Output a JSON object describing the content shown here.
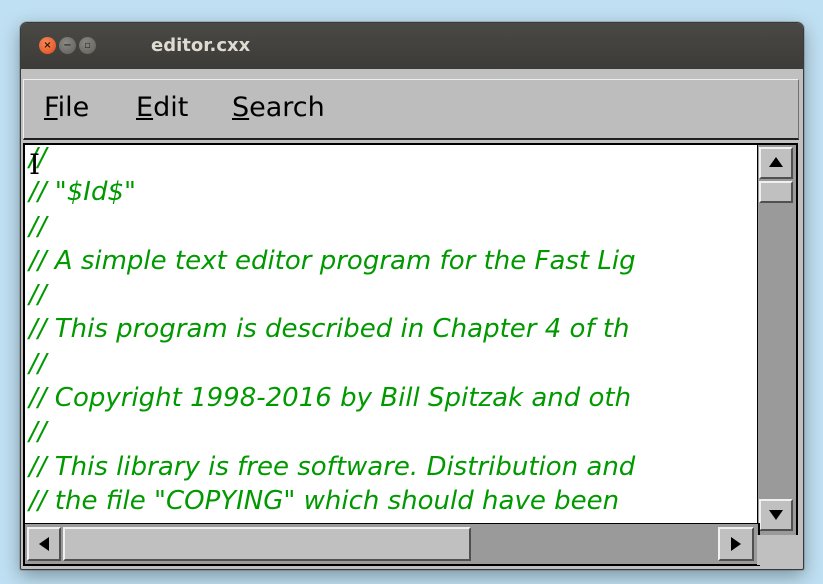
{
  "window": {
    "title": "editor.cxx",
    "close_glyph": "×",
    "minimize_glyph": "−",
    "maximize_glyph": "▫"
  },
  "menubar": {
    "items": [
      {
        "mnemonic": "F",
        "rest": "ile"
      },
      {
        "mnemonic": "E",
        "rest": "dit"
      },
      {
        "mnemonic": "S",
        "rest": "earch"
      }
    ]
  },
  "editor": {
    "text_color": "#009900",
    "cursor_glyph": "I",
    "lines": [
      "//",
      "// \"$Id$\"",
      "//",
      "// A simple text editor program for the Fast Lig",
      "//",
      "// This program is described in Chapter 4 of th",
      "//",
      "// Copyright 1998-2016 by Bill Spitzak and oth",
      "//",
      "// This library is free software. Distribution and",
      "// the file \"COPYING\" which should have been"
    ]
  },
  "scrollbars": {
    "vertical": {
      "up_icon": "arrow-up",
      "down_icon": "arrow-down"
    },
    "horizontal": {
      "left_icon": "arrow-left",
      "right_icon": "arrow-right"
    }
  }
}
